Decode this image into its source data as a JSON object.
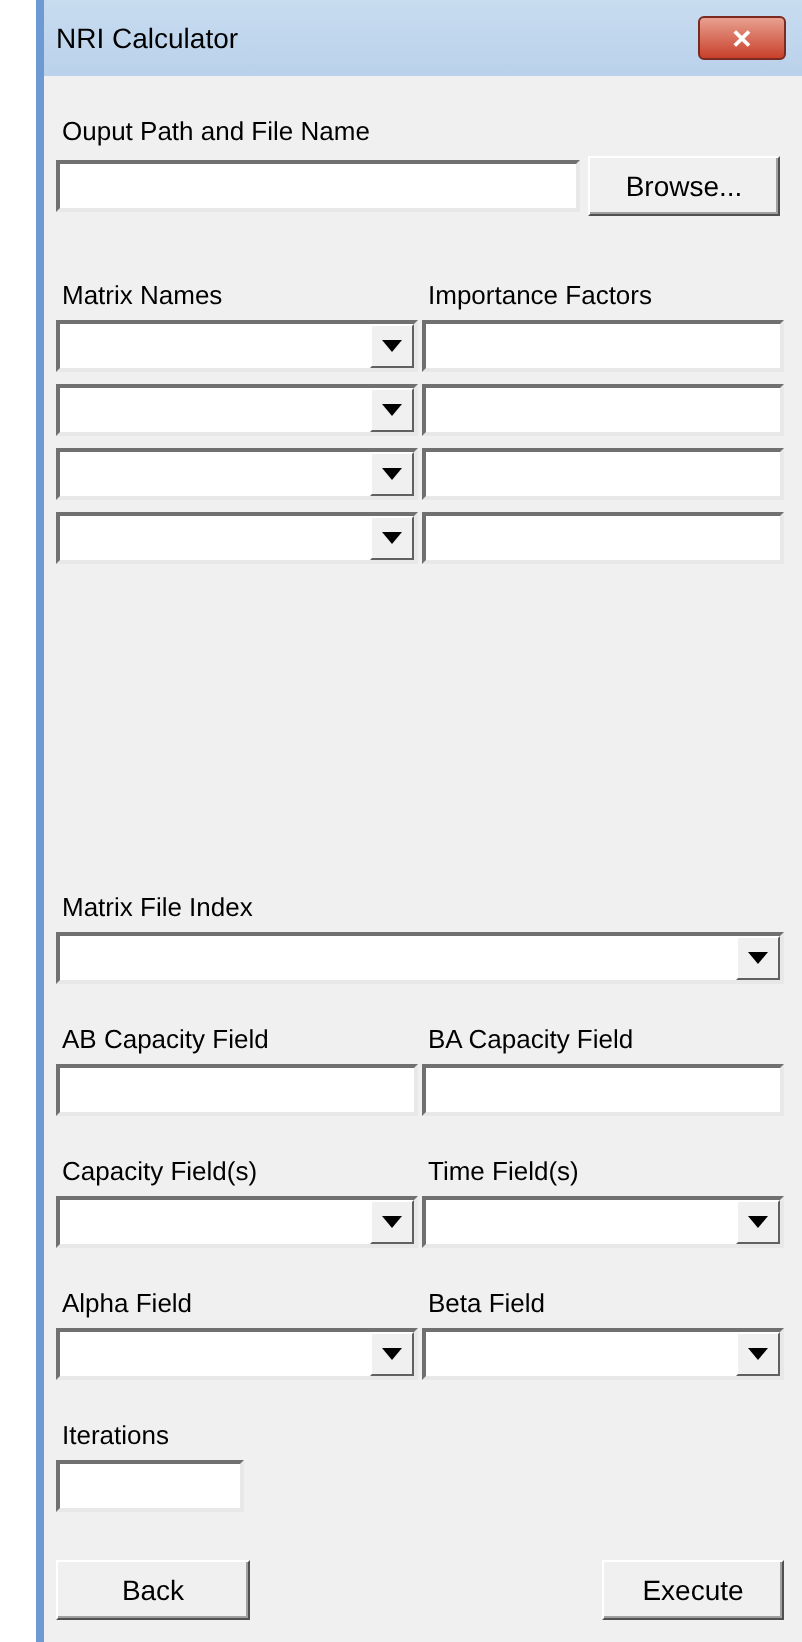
{
  "window": {
    "title": "NRI Calculator",
    "close": "✕"
  },
  "output": {
    "label": "Ouput Path and File Name",
    "browse": "Browse..."
  },
  "matrix": {
    "columns": [
      "Matrix Names",
      "Importance Factors"
    ],
    "rows": [
      {
        "cells": [
          {
            "kind": "dropdown"
          },
          {
            "kind": "text"
          }
        ]
      },
      {
        "cells": [
          {
            "kind": "dropdown"
          },
          {
            "kind": "text"
          }
        ]
      },
      {
        "cells": [
          {
            "kind": "dropdown"
          },
          {
            "kind": "text"
          }
        ]
      },
      {
        "cells": [
          {
            "kind": "dropdown"
          },
          {
            "kind": "text"
          }
        ]
      }
    ]
  },
  "index": {
    "label": "Matrix File Index",
    "kind": "dropdown"
  },
  "field_pairs": [
    [
      {
        "label": "AB Capacity Field",
        "kind": "text"
      },
      {
        "label": "BA Capacity Field",
        "kind": "text"
      }
    ],
    [
      {
        "label": "Capacity Field(s)",
        "kind": "dropdown"
      },
      {
        "label": "Time Field(s)",
        "kind": "dropdown"
      }
    ],
    [
      {
        "label": "Alpha Field",
        "kind": "dropdown"
      },
      {
        "label": "Beta Field",
        "kind": "dropdown"
      }
    ]
  ],
  "iterations": {
    "label": "Iterations",
    "kind": "text"
  },
  "buttons": [
    "Back",
    "Execute"
  ]
}
